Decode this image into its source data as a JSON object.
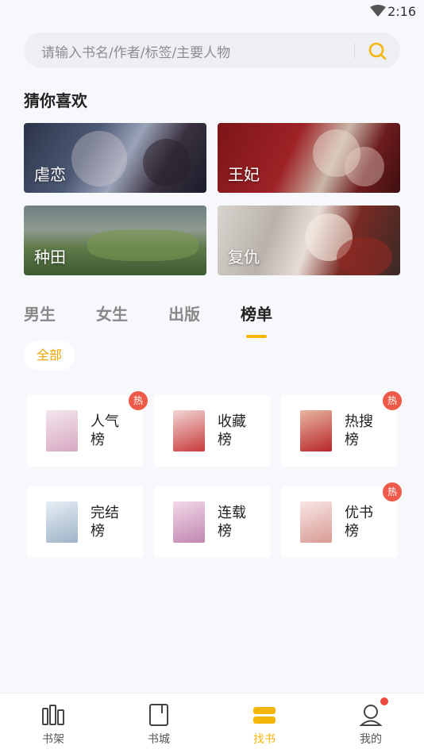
{
  "status_bar": {
    "time": "2:16"
  },
  "search": {
    "placeholder": "请输入书名/作者/标签/主要人物"
  },
  "section": {
    "title": "猜你喜欢"
  },
  "genres": [
    {
      "label": "虐恋"
    },
    {
      "label": "王妃"
    },
    {
      "label": "种田"
    },
    {
      "label": "复仇"
    }
  ],
  "tabs": [
    {
      "label": "男生",
      "active": false
    },
    {
      "label": "女生",
      "active": false
    },
    {
      "label": "出版",
      "active": false
    },
    {
      "label": "榜单",
      "active": true
    }
  ],
  "filter": {
    "label": "全部"
  },
  "rankings": [
    {
      "name": "人气榜",
      "hot": true,
      "hot_label": "热",
      "cover_color": "#e6c8d6"
    },
    {
      "name": "收藏榜",
      "hot": false,
      "hot_label": "",
      "cover_color": "#c83a3a"
    },
    {
      "name": "热搜榜",
      "hot": true,
      "hot_label": "热",
      "cover_color": "#b8262a"
    },
    {
      "name": "完结榜",
      "hot": false,
      "hot_label": "",
      "cover_color": "#b7c6d6"
    },
    {
      "name": "连载榜",
      "hot": false,
      "hot_label": "",
      "cover_color": "#d9a8c6"
    },
    {
      "name": "优书榜",
      "hot": true,
      "hot_label": "热",
      "cover_color": "#e9c6c2"
    }
  ],
  "bottom_nav": [
    {
      "label": "书架",
      "icon": "bookshelf-icon",
      "active": false
    },
    {
      "label": "书城",
      "icon": "bookstore-icon",
      "active": false
    },
    {
      "label": "找书",
      "icon": "find-book-icon",
      "active": true
    },
    {
      "label": "我的",
      "icon": "profile-icon",
      "active": false,
      "badge": true
    }
  ],
  "colors": {
    "accent": "#f5b60a",
    "hot": "#ee5a4a",
    "background": "#f7f8fc"
  }
}
